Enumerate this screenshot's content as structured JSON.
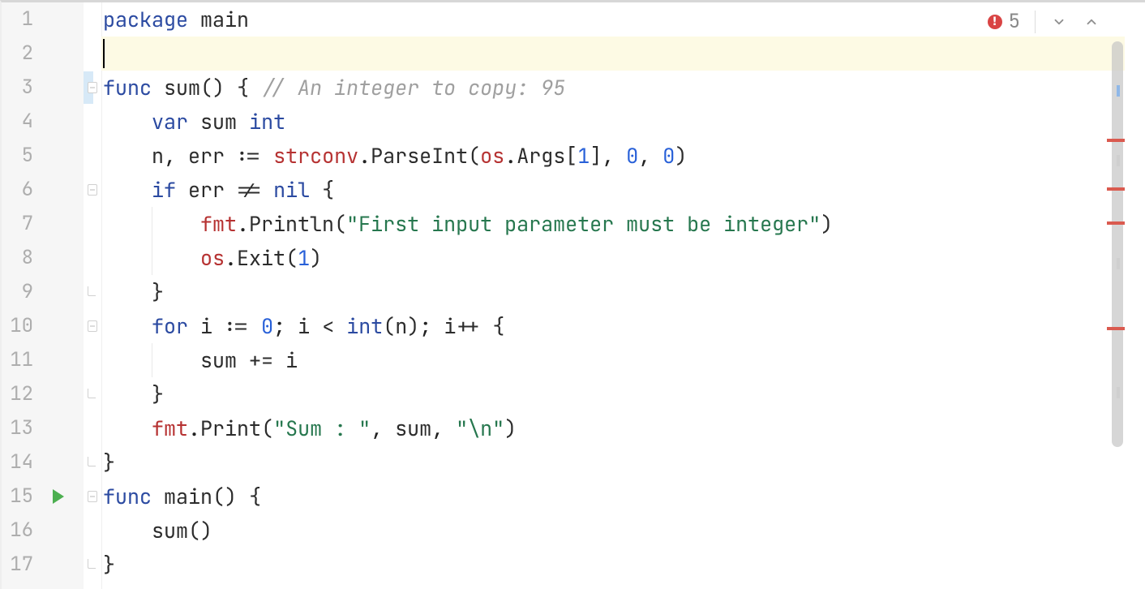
{
  "inspections": {
    "error_count": "5",
    "error_icon_glyph": "!"
  },
  "line_numbers": [
    "1",
    "2",
    "3",
    "4",
    "5",
    "6",
    "7",
    "8",
    "9",
    "10",
    "11",
    "12",
    "13",
    "14",
    "15",
    "16",
    "17"
  ],
  "cursor": {
    "line": 2,
    "column": 1
  },
  "code": {
    "l1": {
      "kw1": "package",
      "sp1": " ",
      "id1": "main"
    },
    "l2": {
      "text": ""
    },
    "l3": {
      "kw1": "func",
      "sp1": " ",
      "id1": "sum",
      "par1": "()",
      "sp2": " ",
      "br1": "{",
      "sp3": " ",
      "comment": "// An integer to copy: 95"
    },
    "l4": {
      "indent": "    ",
      "kw1": "var",
      "sp1": " ",
      "id1": "sum",
      "sp2": " ",
      "type1": "int"
    },
    "l5": {
      "indent": "    ",
      "id1": "n",
      "c1": ", ",
      "id2": "err",
      "sp1": " ",
      "op1": ":=",
      "sp2": " ",
      "pkg1": "strconv",
      "dot1": ".",
      "fn1": "ParseInt",
      "par1": "(",
      "pkg2": "os",
      "dot2": ".",
      "id3": "Args[",
      "num1": "1",
      "id4": "]",
      "c2": ", ",
      "num2": "0",
      "c3": ", ",
      "num3": "0",
      "par2": ")"
    },
    "l6": {
      "indent": "    ",
      "kw1": "if",
      "sp1": " ",
      "id1": "err",
      "sp2": " ",
      "op1": "!=",
      "sp3": " ",
      "kw2": "nil",
      "sp4": " ",
      "br1": "{"
    },
    "l7": {
      "indent": "        ",
      "pkg1": "fmt",
      "dot1": ".",
      "fn1": "Println",
      "par1": "(",
      "str1": "\"First input parameter must be integer\"",
      "par2": ")"
    },
    "l8": {
      "indent": "        ",
      "pkg1": "os",
      "dot1": ".",
      "fn1": "Exit",
      "par1": "(",
      "num1": "1",
      "par2": ")"
    },
    "l9": {
      "indent": "    ",
      "br1": "}"
    },
    "l10": {
      "indent": "    ",
      "kw1": "for",
      "sp1": " ",
      "id1": "i",
      "sp2": " ",
      "op1": ":=",
      "sp3": " ",
      "num1": "0",
      "sc1": ";",
      "sp4": " ",
      "id2": "i",
      "sp5": " ",
      "op2": "<",
      "sp6": " ",
      "type1": "int",
      "par1": "(",
      "id3": "n",
      "par2": ")",
      "sc2": ";",
      "sp7": " ",
      "id4": "i++",
      "sp8": " ",
      "br1": "{"
    },
    "l11": {
      "indent": "        ",
      "id1": "sum",
      "sp1": " ",
      "op1": "+=",
      "sp2": " ",
      "id2": "i"
    },
    "l12": {
      "indent": "    ",
      "br1": "}"
    },
    "l13": {
      "indent": "    ",
      "pkg1": "fmt",
      "dot1": ".",
      "fn1": "Print",
      "par1": "(",
      "str1": "\"Sum : \"",
      "c1": ", ",
      "id1": "sum",
      "c2": ", ",
      "str2": "\"\\n\"",
      "par2": ")"
    },
    "l14": {
      "br1": "}"
    },
    "l15": {
      "kw1": "func",
      "sp1": " ",
      "id1": "main",
      "par1": "()",
      "sp2": " ",
      "br1": "{"
    },
    "l16": {
      "indent": "    ",
      "id1": "sum",
      "par1": "()"
    },
    "l17": {
      "br1": "}"
    }
  }
}
